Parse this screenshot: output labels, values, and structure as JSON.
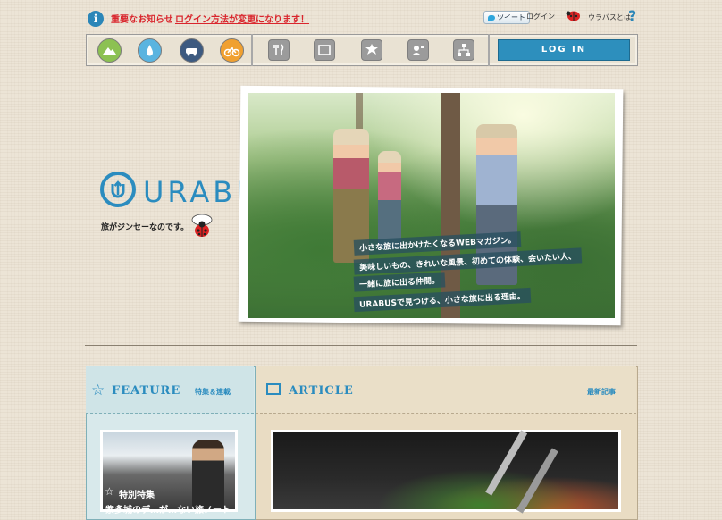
{
  "topbar": {
    "notice_label": "重要なお知らせ",
    "notice_link": "ログイン方法が変更になります！",
    "tweet_label": "ツイート",
    "login_link": "ログイン",
    "about_link": "ウラバスとは",
    "help_label": "?"
  },
  "nav": {
    "categories": [
      "mountain-icon",
      "water-drop-icon",
      "car-icon",
      "bicycle-icon"
    ],
    "category_colors": [
      "#8cc152",
      "#5ab4e0",
      "#3d5a80",
      "#f0a030"
    ],
    "services": [
      "fork-knife-icon",
      "screen-icon",
      "badge-icon",
      "profile-icon",
      "network-icon"
    ],
    "login_button": "LOG IN"
  },
  "brand": {
    "logo_text": "URABUS",
    "tagline": "旅がジンセーなのです。",
    "accent": "#2b8cbf"
  },
  "hero": {
    "captions": [
      "小さな旅に出かけたくなるWEBマガジン。",
      "美味しいもの、きれいな風景、初めての体験、会いたい人、",
      "一緒に旅に出る仲間。",
      "URABUSで見つける、小さな旅に出る理由。"
    ]
  },
  "feature": {
    "title": "FEATURE",
    "subtitle": "特集＆連載",
    "badge": "特別特集",
    "caption": "紫多城のデ…が…ない旅ノート"
  },
  "article": {
    "title": "ARTICLE",
    "subtitle": "最新記事"
  }
}
